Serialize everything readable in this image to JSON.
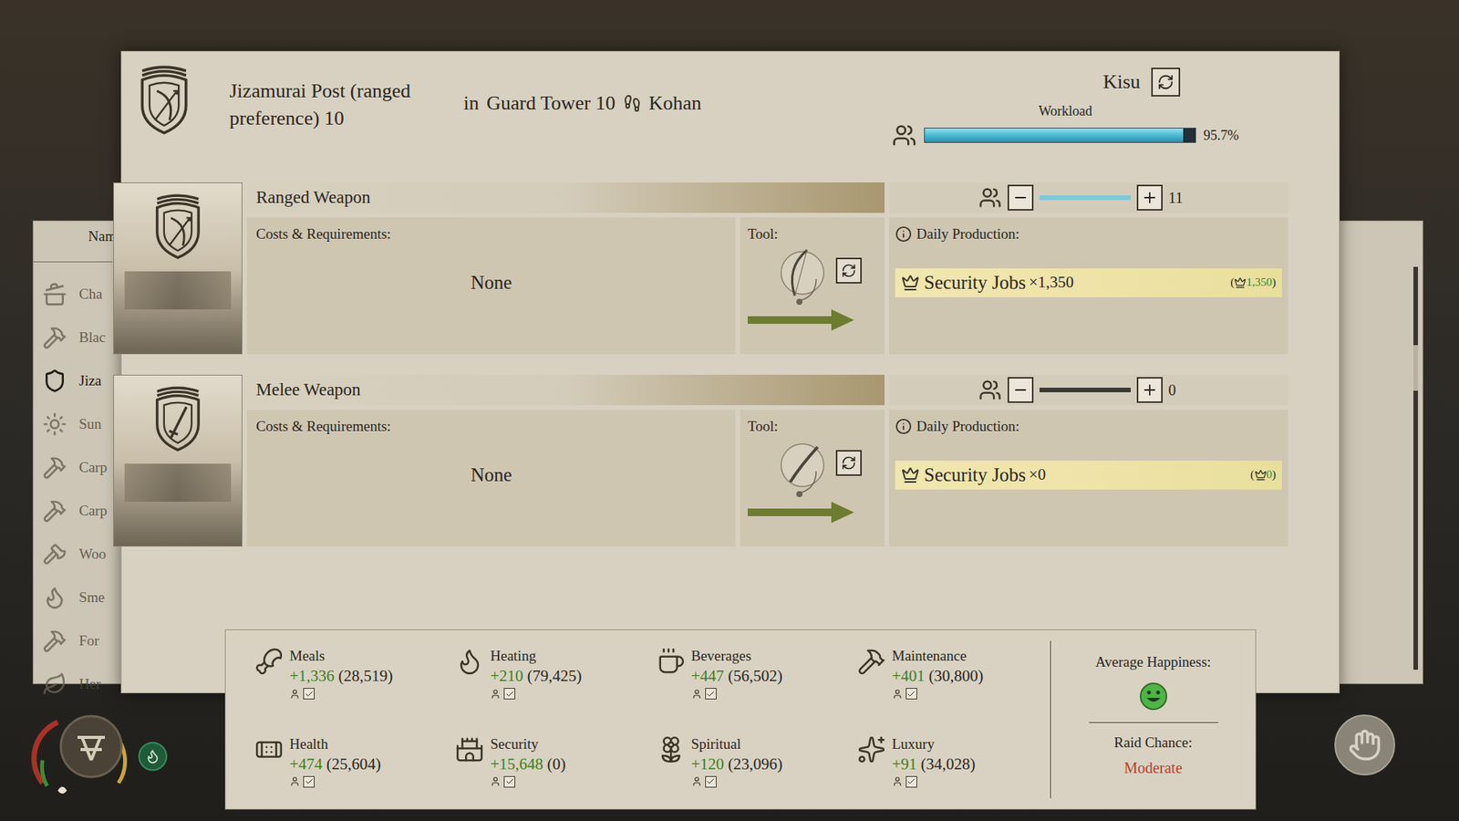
{
  "header": {
    "title": "Jizamurai Post (ranged preference) 10",
    "connector": "in",
    "building": "Guard Tower 10",
    "village": "Kohan",
    "worker": "Kisu",
    "workload_label": "Workload",
    "workload_reading": "95.7%",
    "workload_level": 0.957
  },
  "recipes": [
    {
      "name": "Ranged Weapon",
      "kind": "bow",
      "costs_label": "Costs & Requirements:",
      "costs": "None",
      "tool_label": "Tool:",
      "workers": "11",
      "worker_level": 1,
      "production_label": "Daily Production:",
      "output": "Security Jobs",
      "count": "×1,350",
      "total_open": "(",
      "total": "1,350",
      "total_close": ")"
    },
    {
      "name": "Melee Weapon",
      "kind": "sword",
      "costs_label": "Costs & Requirements:",
      "costs": "None",
      "tool_label": "Tool:",
      "workers": "0",
      "worker_level": 0,
      "production_label": "Daily Production:",
      "output": "Security Jobs",
      "count": "×0",
      "total_open": "(",
      "total": "0",
      "total_close": ")"
    }
  ],
  "stats": [
    {
      "name": "Meals",
      "delta": "+1,336",
      "total": "(28,519)",
      "checked": true
    },
    {
      "name": "Heating",
      "delta": "+210",
      "total": "(79,425)",
      "checked": true
    },
    {
      "name": "Beverages",
      "delta": "+447",
      "total": "(56,502)",
      "checked": true
    },
    {
      "name": "Maintenance",
      "delta": "+401",
      "total": "(30,800)",
      "checked": true
    },
    {
      "name": "Health",
      "delta": "+474",
      "total": "(25,604)",
      "checked": true
    },
    {
      "name": "Security",
      "delta": "+15,648",
      "total": "(0)",
      "checked": true
    },
    {
      "name": "Spiritual",
      "delta": "+120",
      "total": "(23,096)",
      "checked": true
    },
    {
      "name": "Luxury",
      "delta": "+91",
      "total": "(34,028)",
      "checked": true
    }
  ],
  "summary": {
    "happiness_label": "Average Happiness:",
    "raid_label": "Raid Chance:",
    "raid_value": "Moderate"
  },
  "sidebar": {
    "header": "Nam",
    "items": [
      {
        "label": "Cha",
        "selected": false
      },
      {
        "label": "Blac",
        "selected": false
      },
      {
        "label": "Jiza",
        "selected": true
      },
      {
        "label": "Sun",
        "selected": false
      },
      {
        "label": "Carp",
        "selected": false
      },
      {
        "label": "Carp",
        "selected": false
      },
      {
        "label": "Woo",
        "selected": false
      },
      {
        "label": "Sme",
        "selected": false
      },
      {
        "label": "For",
        "selected": false
      },
      {
        "label": "Her",
        "selected": false
      }
    ]
  }
}
